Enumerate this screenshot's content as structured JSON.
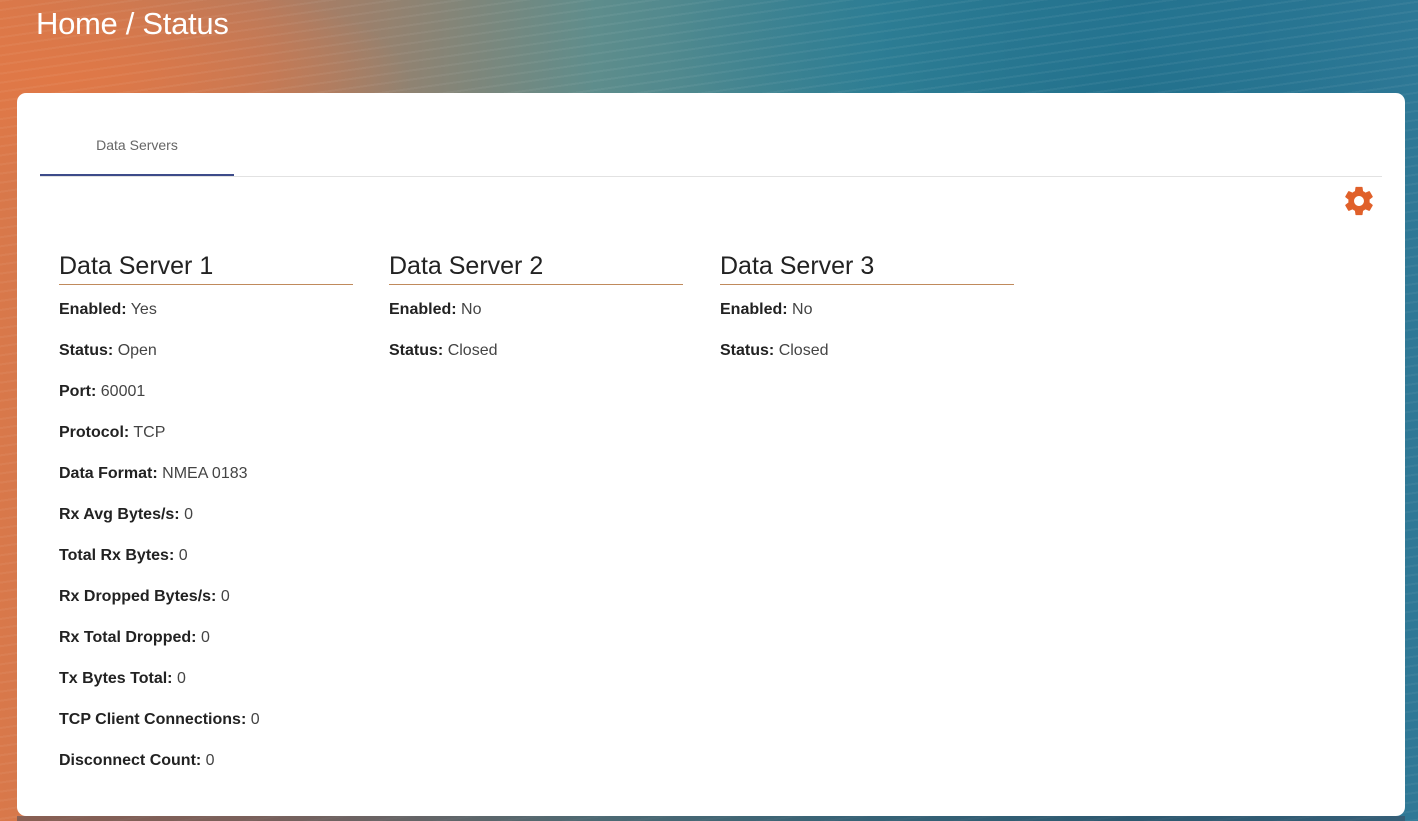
{
  "header": {
    "breadcrumb": "Home / Status"
  },
  "tabs": [
    {
      "label": "Data Servers",
      "active": true
    }
  ],
  "toolbar": {
    "settings_icon": "gear-icon",
    "settings_color": "#e0602a"
  },
  "servers": [
    {
      "title": "Data Server 1",
      "fields": [
        {
          "label": "Enabled:",
          "value": "Yes"
        },
        {
          "label": "Status:",
          "value": "Open"
        },
        {
          "label": "Port:",
          "value": "60001"
        },
        {
          "label": "Protocol:",
          "value": "TCP"
        },
        {
          "label": "Data Format:",
          "value": "NMEA 0183"
        },
        {
          "label": "Rx Avg Bytes/s:",
          "value": "0"
        },
        {
          "label": "Total Rx Bytes:",
          "value": "0"
        },
        {
          "label": "Rx Dropped Bytes/s:",
          "value": "0"
        },
        {
          "label": "Rx Total Dropped:",
          "value": "0"
        },
        {
          "label": "Tx Bytes Total:",
          "value": "0"
        },
        {
          "label": "TCP Client Connections:",
          "value": "0"
        },
        {
          "label": "Disconnect Count:",
          "value": "0"
        }
      ]
    },
    {
      "title": "Data Server 2",
      "fields": [
        {
          "label": "Enabled:",
          "value": "No"
        },
        {
          "label": "Status:",
          "value": "Closed"
        }
      ]
    },
    {
      "title": "Data Server 3",
      "fields": [
        {
          "label": "Enabled:",
          "value": "No"
        },
        {
          "label": "Status:",
          "value": "Closed"
        }
      ]
    }
  ],
  "colors": {
    "tab_underline": "#3d4b8a",
    "heading_underline": "#c08a5c",
    "accent": "#e0602a"
  }
}
